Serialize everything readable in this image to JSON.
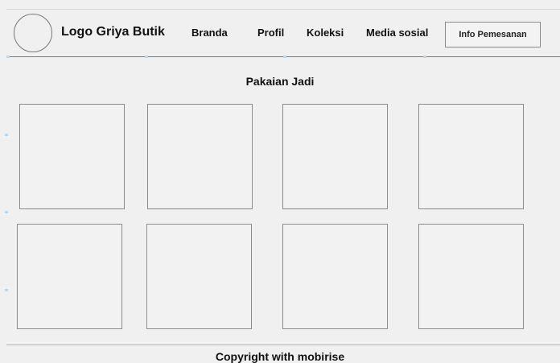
{
  "header": {
    "logo_text": "Logo Griya Butik",
    "nav": [
      {
        "label": "Branda"
      },
      {
        "label": "Profil"
      },
      {
        "label": "Koleksi"
      },
      {
        "label": "Media sosial"
      }
    ],
    "cta_label": "Info Pemesanan"
  },
  "main": {
    "section_title": "Pakaian Jadi",
    "grid_rows": 2,
    "grid_columns": 4
  },
  "footer": {
    "text": "Copyright with mobirise"
  },
  "colors": {
    "background": "#f0f0f0",
    "border": "#8a8a8a",
    "text": "#111111",
    "marker": "#b9d8ef"
  }
}
